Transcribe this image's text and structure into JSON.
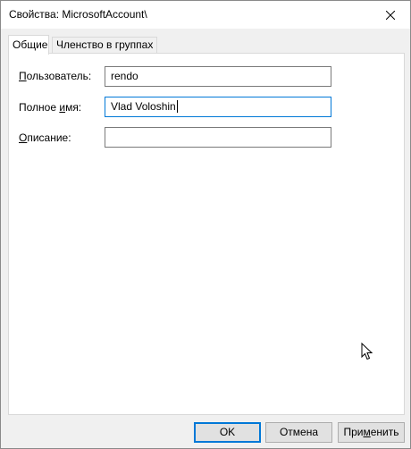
{
  "window": {
    "title": "Свойства: MicrosoftAccount\\"
  },
  "tabs": [
    {
      "label": "Общие",
      "active": true
    },
    {
      "label": "Членство в группах",
      "active": false
    }
  ],
  "form": {
    "user": {
      "label_u": "П",
      "label_rest": "ользователь:",
      "value": "rendo"
    },
    "fullname": {
      "label_pre": "Полное ",
      "label_u": "и",
      "label_rest": "мя:",
      "value": "Vlad Voloshin"
    },
    "description": {
      "label_u": "О",
      "label_rest": "писание:",
      "value": ""
    }
  },
  "buttons": {
    "ok": "OK",
    "cancel": "Отмена",
    "apply_pre": "При",
    "apply_u": "м",
    "apply_rest": "енить"
  },
  "colors": {
    "focus": "#0078d7"
  }
}
